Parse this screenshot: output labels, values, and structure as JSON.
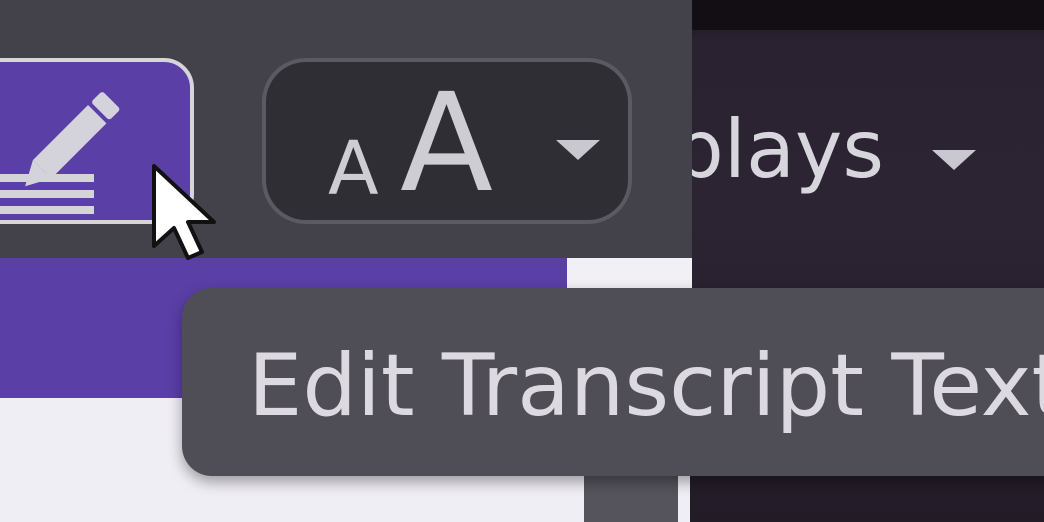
{
  "toolbar": {
    "edit_button": {
      "icon": "pencil-lines-icon",
      "active": true
    },
    "text_size_button": {
      "icon": "text-size-icon",
      "small_glyph": "A",
      "large_glyph": "A",
      "caret_icon": "caret-down-icon"
    },
    "displays_dropdown": {
      "label": "Displays",
      "caret_icon": "caret-down-icon"
    }
  },
  "progress": {
    "value_percent": 82
  },
  "tooltip": {
    "text": "Edit Transcript Text"
  },
  "colors": {
    "accent": "#5a3fa6",
    "toolbar_bg": "#43424a",
    "tooltip_bg": "#4f4e56",
    "text_light": "#dcdae0"
  }
}
